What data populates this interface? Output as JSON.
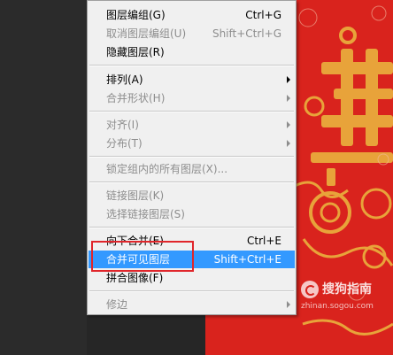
{
  "menu": {
    "items": [
      {
        "label": "图层编组(G)",
        "shortcut": "Ctrl+G",
        "disabled": false,
        "submenu": false
      },
      {
        "label": "取消图层编组(U)",
        "shortcut": "Shift+Ctrl+G",
        "disabled": true,
        "submenu": false
      },
      {
        "label": "隐藏图层(R)",
        "shortcut": "",
        "disabled": false,
        "submenu": false
      },
      {
        "label": "排列(A)",
        "shortcut": "",
        "disabled": false,
        "submenu": true
      },
      {
        "label": "合并形状(H)",
        "shortcut": "",
        "disabled": true,
        "submenu": true
      },
      {
        "label": "对齐(I)",
        "shortcut": "",
        "disabled": true,
        "submenu": true
      },
      {
        "label": "分布(T)",
        "shortcut": "",
        "disabled": true,
        "submenu": true
      },
      {
        "label": "锁定组内的所有图层(X)...",
        "shortcut": "",
        "disabled": true,
        "submenu": false
      },
      {
        "label": "链接图层(K)",
        "shortcut": "",
        "disabled": true,
        "submenu": false
      },
      {
        "label": "选择链接图层(S)",
        "shortcut": "",
        "disabled": true,
        "submenu": false
      },
      {
        "label": "向下合并(E)",
        "shortcut": "Ctrl+E",
        "disabled": false,
        "submenu": false
      },
      {
        "label": "合并可见图层",
        "shortcut": "Shift+Ctrl+E",
        "disabled": false,
        "submenu": false,
        "selected": true
      },
      {
        "label": "拼合图像(F)",
        "shortcut": "",
        "disabled": false,
        "submenu": false
      },
      {
        "label": "修边",
        "shortcut": "",
        "disabled": true,
        "submenu": true
      }
    ]
  },
  "watermark": {
    "name": "搜狗指南",
    "url": "zhinan.sogou.com"
  },
  "colors": {
    "menu_bg": "#f0f0f0",
    "selection": "#3399ff",
    "highlight_box": "#e0262b",
    "artwork_red": "#d9231d",
    "artwork_gold": "#e8a33a"
  }
}
